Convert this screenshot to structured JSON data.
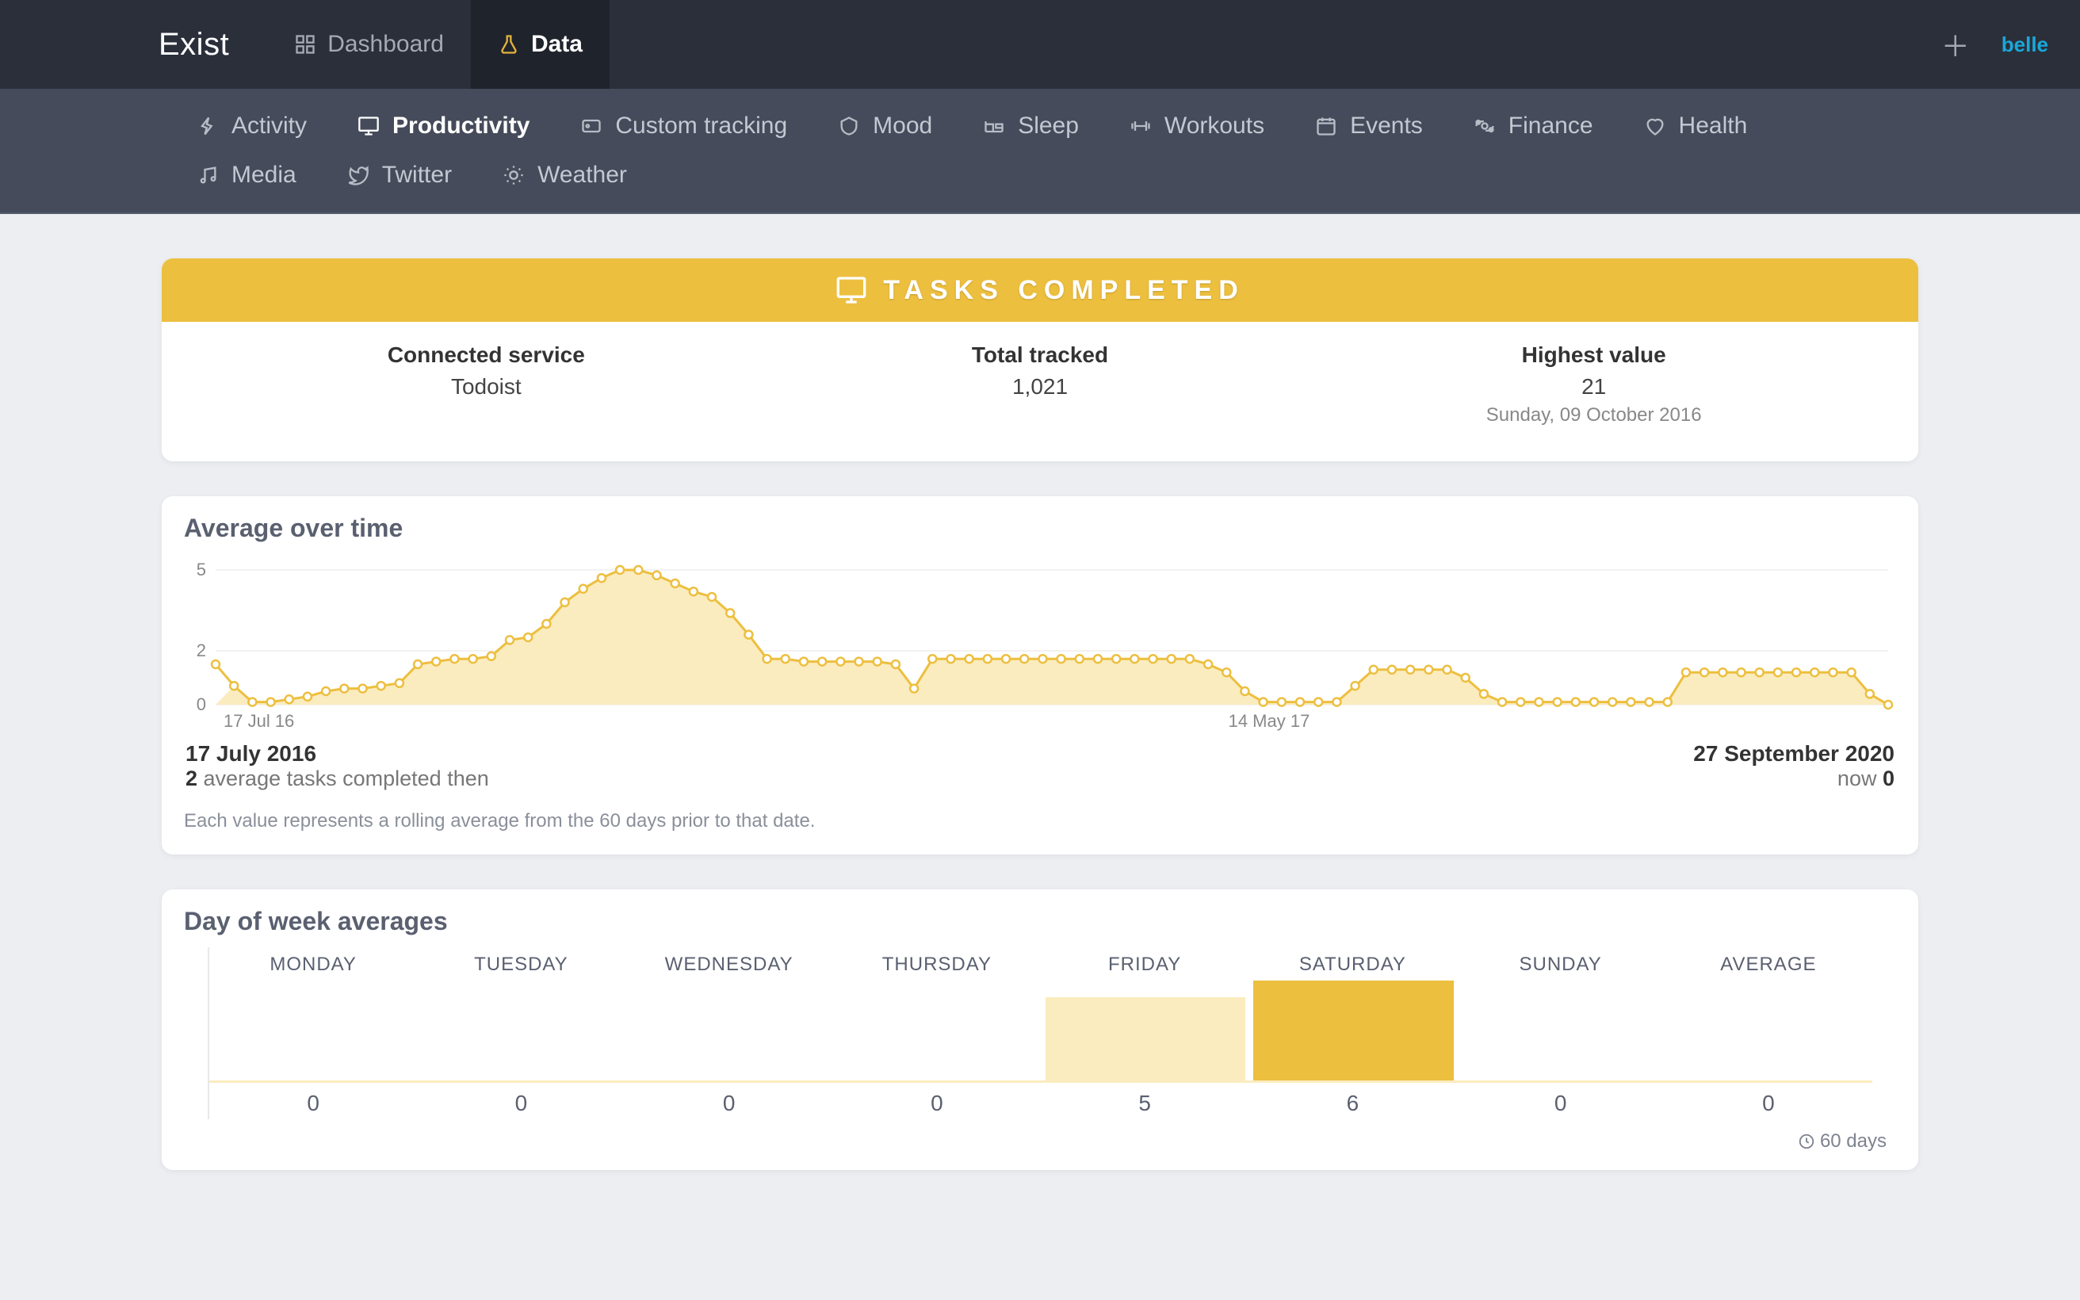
{
  "brand": "Exist",
  "topnav": {
    "dashboard": "Dashboard",
    "data": "Data"
  },
  "user": "belle",
  "subnav": [
    {
      "id": "activity",
      "label": "Activity"
    },
    {
      "id": "productivity",
      "label": "Productivity"
    },
    {
      "id": "custom",
      "label": "Custom tracking"
    },
    {
      "id": "mood",
      "label": "Mood"
    },
    {
      "id": "sleep",
      "label": "Sleep"
    },
    {
      "id": "workouts",
      "label": "Workouts"
    },
    {
      "id": "events",
      "label": "Events"
    },
    {
      "id": "finance",
      "label": "Finance"
    },
    {
      "id": "health",
      "label": "Health"
    },
    {
      "id": "media",
      "label": "Media"
    },
    {
      "id": "twitter",
      "label": "Twitter"
    },
    {
      "id": "weather",
      "label": "Weather"
    }
  ],
  "subnav_active": "productivity",
  "metric_header": "TASKS COMPLETED",
  "stats": {
    "connected_label": "Connected service",
    "connected_value": "Todoist",
    "total_label": "Total tracked",
    "total_value": "1,021",
    "highest_label": "Highest value",
    "highest_value": "21",
    "highest_sub": "Sunday, 09 October 2016"
  },
  "chart": {
    "title": "Average over time",
    "start_date": "17 July 2016",
    "start_val_prefix": "2",
    "start_val_suffix": " average tasks completed then",
    "end_date": "27 September 2020",
    "end_val_prefix": "now ",
    "end_val_suffix": "0",
    "footnote": "Each value represents a rolling average from the 60 days prior to that date.",
    "x_tick_start": "17 Jul 16",
    "x_tick_mid": "14 May 17"
  },
  "chart_data": {
    "type": "line",
    "title": "Average over time",
    "xlabel": "",
    "ylabel": "",
    "ylim": [
      0,
      5
    ],
    "x_ticks": [
      "17 Jul 16",
      "14 May 17"
    ],
    "y_ticks": [
      0,
      2,
      5
    ],
    "x_range": [
      "2016-07-17",
      "2020-09-27"
    ],
    "values": [
      1.5,
      0.7,
      0.1,
      0.1,
      0.2,
      0.3,
      0.5,
      0.6,
      0.6,
      0.7,
      0.8,
      1.5,
      1.6,
      1.7,
      1.7,
      1.8,
      2.4,
      2.5,
      3.0,
      3.8,
      4.3,
      4.7,
      5.0,
      5.0,
      4.8,
      4.5,
      4.2,
      4.0,
      3.4,
      2.6,
      1.7,
      1.7,
      1.6,
      1.6,
      1.6,
      1.6,
      1.6,
      1.5,
      0.6,
      1.7,
      1.7,
      1.7,
      1.7,
      1.7,
      1.7,
      1.7,
      1.7,
      1.7,
      1.7,
      1.7,
      1.7,
      1.7,
      1.7,
      1.7,
      1.5,
      1.2,
      0.5,
      0.1,
      0.1,
      0.1,
      0.1,
      0.1,
      0.7,
      1.3,
      1.3,
      1.3,
      1.3,
      1.3,
      1.0,
      0.4,
      0.1,
      0.1,
      0.1,
      0.1,
      0.1,
      0.1,
      0.1,
      0.1,
      0.1,
      0.1,
      1.2,
      1.2,
      1.2,
      1.2,
      1.2,
      1.2,
      1.2,
      1.2,
      1.2,
      1.2,
      0.4,
      0.0
    ]
  },
  "dow": {
    "title": "Day of week averages",
    "labels": [
      "MONDAY",
      "TUESDAY",
      "WEDNESDAY",
      "THURSDAY",
      "FRIDAY",
      "SATURDAY",
      "SUNDAY",
      "AVERAGE"
    ],
    "values": [
      0,
      0,
      0,
      0,
      5,
      6,
      0,
      0
    ],
    "max": 6,
    "foot": "60 days"
  },
  "colors": {
    "accent": "#edbf3f",
    "accent_light": "#fbecbf"
  }
}
